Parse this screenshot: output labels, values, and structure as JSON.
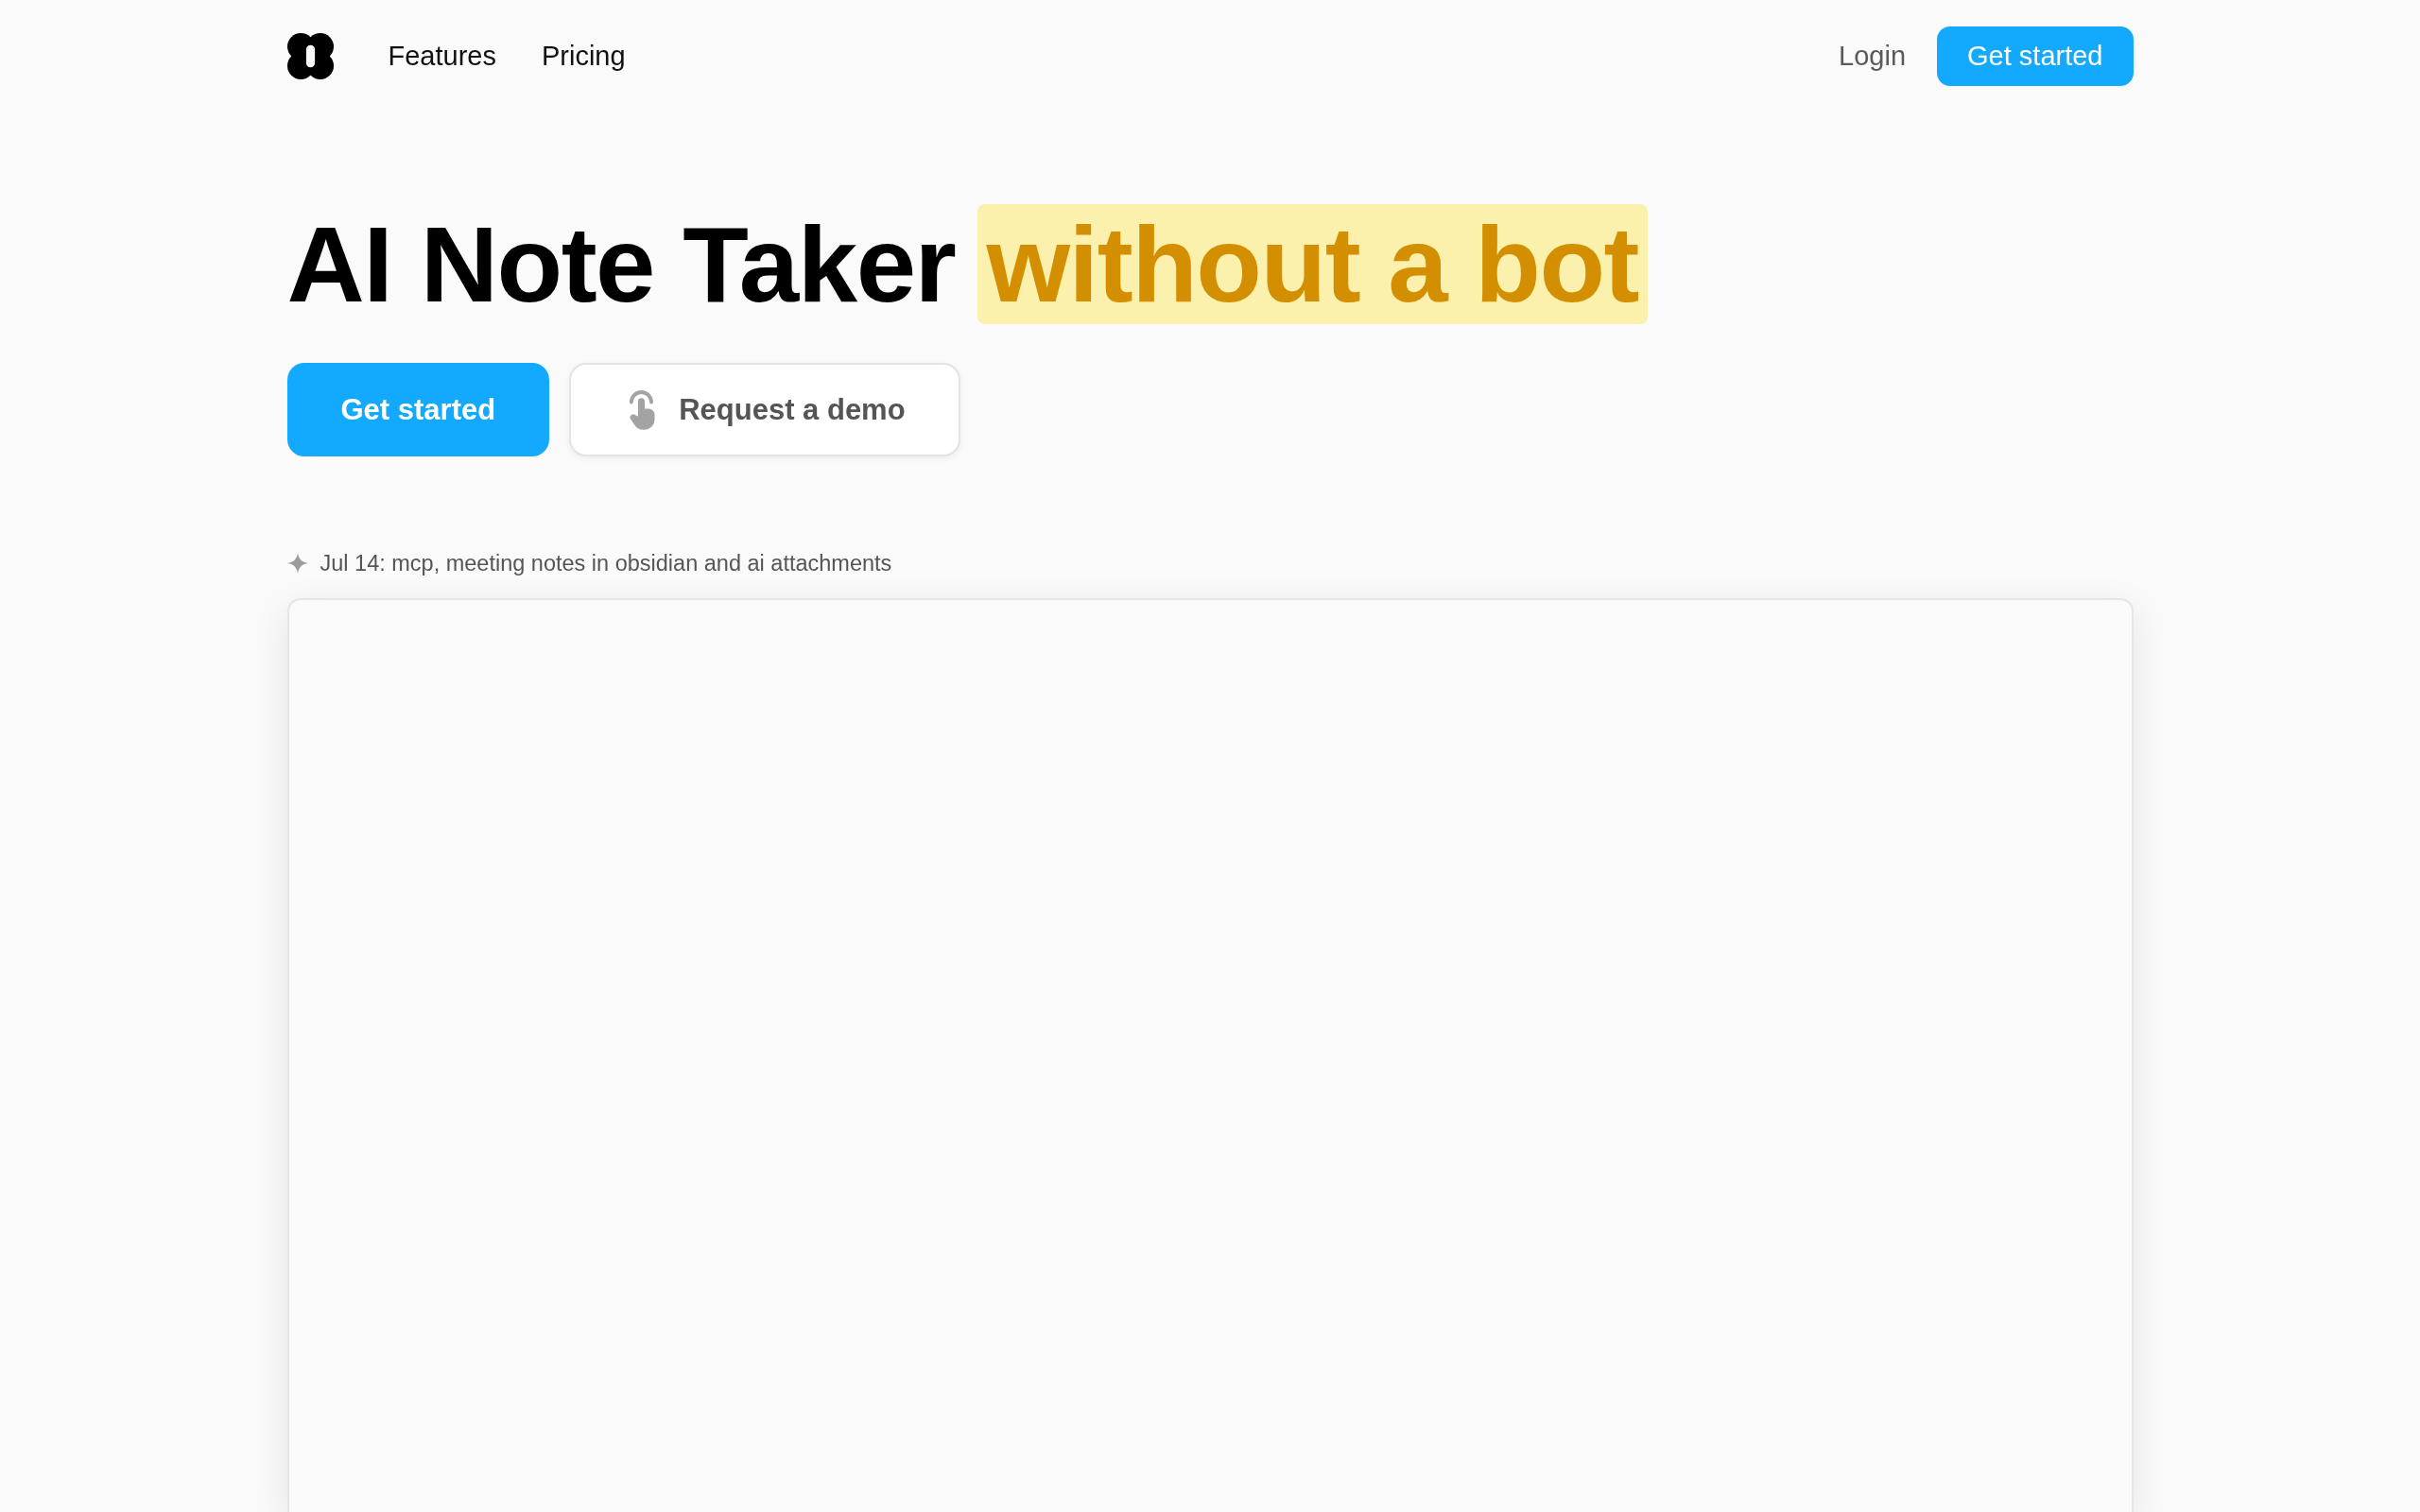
{
  "nav": {
    "links": [
      "Features",
      "Pricing"
    ],
    "login": "Login",
    "cta": "Get started"
  },
  "hero": {
    "title": "AI Note Taker",
    "highlight": "without a bot",
    "buttons": [
      {
        "label": "Get started",
        "kind": "primary"
      },
      {
        "label": "Request a demo",
        "kind": "secondary"
      }
    ]
  },
  "announcement": "Jul 14: mcp, meeting notes in obsidian and ai attachments"
}
